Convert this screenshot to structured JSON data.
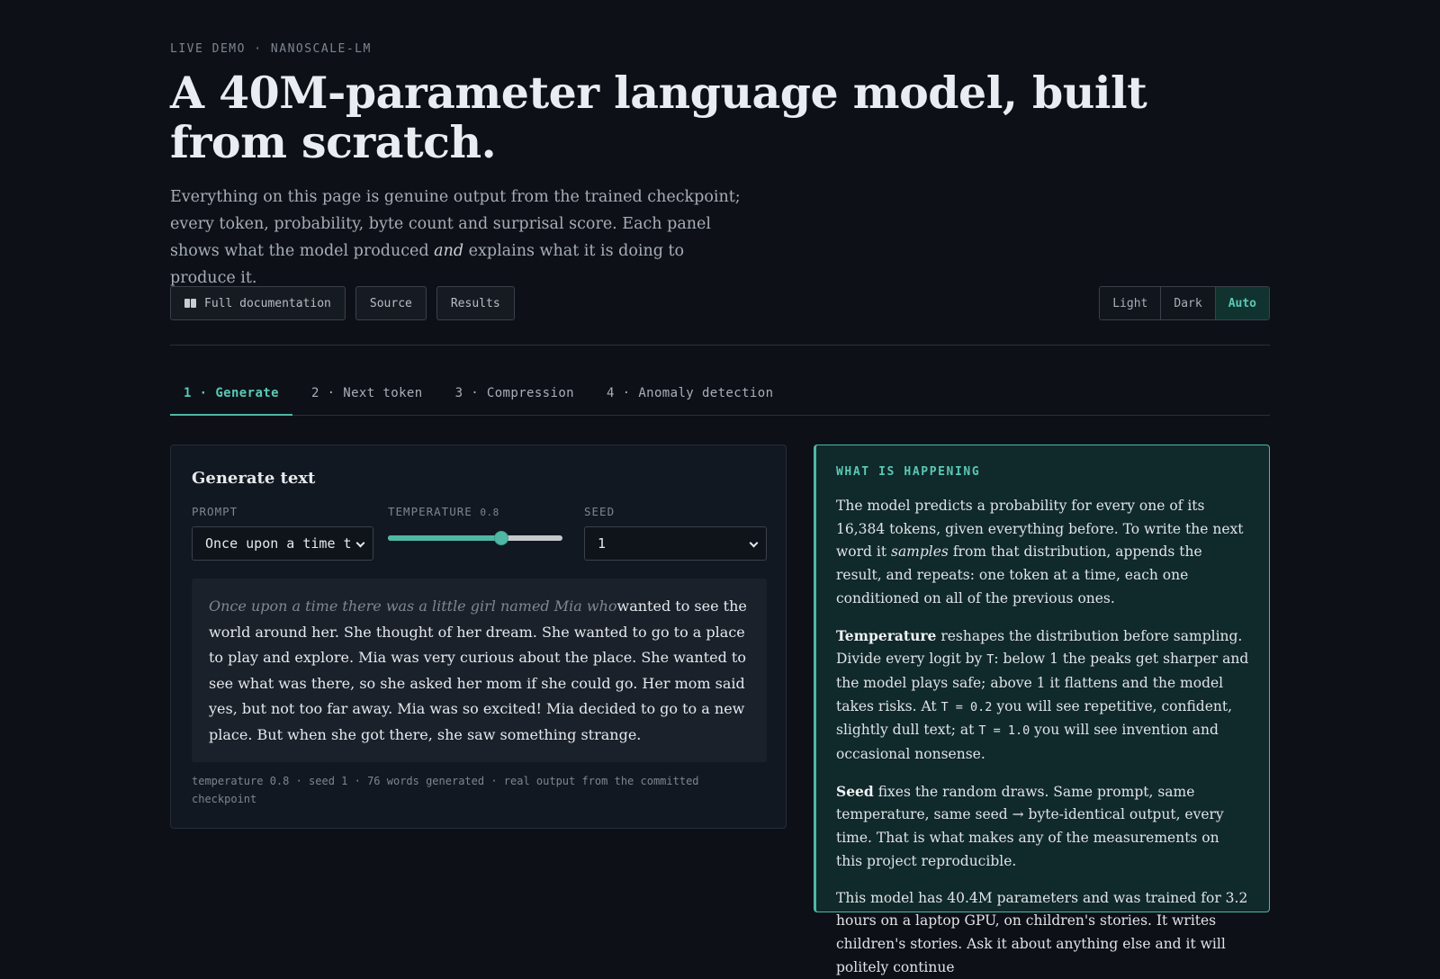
{
  "header": {
    "eyebrow": "LIVE DEMO · NANOSCALE-LM",
    "title": "A 40M-parameter language model, built from scratch.",
    "lede_part1": "Everything on this page is genuine output from the trained checkpoint; every token, probability, byte count and surprisal score. Each panel shows what the model produced ",
    "lede_em": "and",
    "lede_part2": " explains what it is doing to produce it."
  },
  "links": {
    "docs_icon": "book-icon",
    "docs": "Full documentation",
    "source": "Source",
    "results": "Results"
  },
  "theme": {
    "light": "Light",
    "dark": "Dark",
    "auto": "Auto",
    "selected": "Auto",
    "accent": "#5ac8b4"
  },
  "tabs": [
    {
      "label": "1 · Generate",
      "active": true
    },
    {
      "label": "2 · Next token",
      "active": false
    },
    {
      "label": "3 · Compression",
      "active": false
    },
    {
      "label": "4 · Anomaly detection",
      "active": false
    }
  ],
  "generate": {
    "title": "Generate text",
    "prompt_label": "PROMPT",
    "prompt_value": "Once upon a time t",
    "temperature_label": "TEMPERATURE",
    "temperature_value": "0.8",
    "temperature_fraction": 0.65,
    "seed_label": "SEED",
    "seed_value": "1",
    "output_prompt": "Once upon a time there was a little girl named Mia who",
    "output_text": "wanted to see the world around her. She thought of her dream. She wanted to go to a place to play and explore. Mia was very curious about the place. She wanted to see what was there, so she asked her mom if she could go. Her mom said yes, but not too far away. Mia was so excited! Mia decided to go to a new place. But when she got there, she saw something strange.",
    "meta": "temperature 0.8 · seed 1 · 76 words generated · real output from the committed checkpoint"
  },
  "explain": {
    "heading": "WHAT IS HAPPENING",
    "p1_a": "The model predicts a probability for every one of its 16,384 tokens, given everything before. To write the next word it ",
    "p1_em": "samples",
    "p1_b": " from that distribution, appends the result, and repeats: one token at a time, each one conditioned on all of the previous ones.",
    "p2_bold": "Temperature",
    "p2_a": " reshapes the distribution before sampling. Divide every logit by ",
    "p2_code1": "T",
    "p2_b": ": below 1 the peaks get sharper and the model plays safe; above 1 it flattens and the model takes risks. At ",
    "p2_code2": "T = 0.2",
    "p2_c": " you will see repetitive, confident, slightly dull text; at ",
    "p2_code3": "T = 1.0",
    "p2_d": " you will see invention and occasional nonsense.",
    "p3_bold": "Seed",
    "p3_a": " fixes the random draws. Same prompt, same temperature, same seed → byte-identical output, every time. That is what makes any of the measurements on this project reproducible.",
    "p4": "This model has 40.4M parameters and was trained for 3.2 hours on a laptop GPU, on children's stories. It writes children's stories. Ask it about anything else and it will politely continue"
  }
}
